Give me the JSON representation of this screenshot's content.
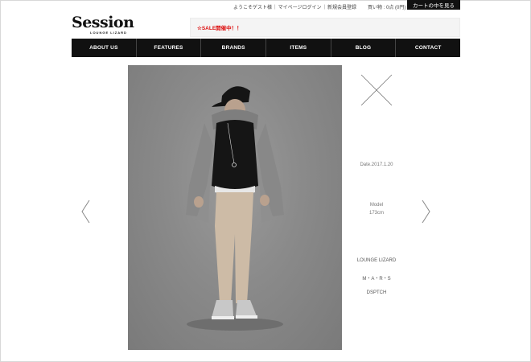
{
  "header": {
    "utility_links": [
      "ようこそゲスト様",
      "マイページログイン",
      "新規会員登録"
    ],
    "cart_count": "買い物 : 0点 (0円)",
    "cart_button": "カートの中を見る"
  },
  "logo": {
    "main": "Session",
    "sub": "LOUNGE LIZARD"
  },
  "notice": {
    "text": "☆SALE開催中！！"
  },
  "nav": {
    "items": [
      "ABOUT US",
      "FEATURES",
      "BRANDS",
      "ITEMS",
      "BLOG",
      "CONTACT"
    ]
  },
  "detail": {
    "date": "Date.2017.1.20",
    "model_label": "Model",
    "model_height": "173cm",
    "brands": [
      "LOUNGE LIZARD",
      "M・A・R・S",
      "DSPTCH"
    ]
  },
  "icons": {
    "prev": "chevron-left-icon",
    "next": "chevron-right-icon",
    "close": "close-icon"
  }
}
